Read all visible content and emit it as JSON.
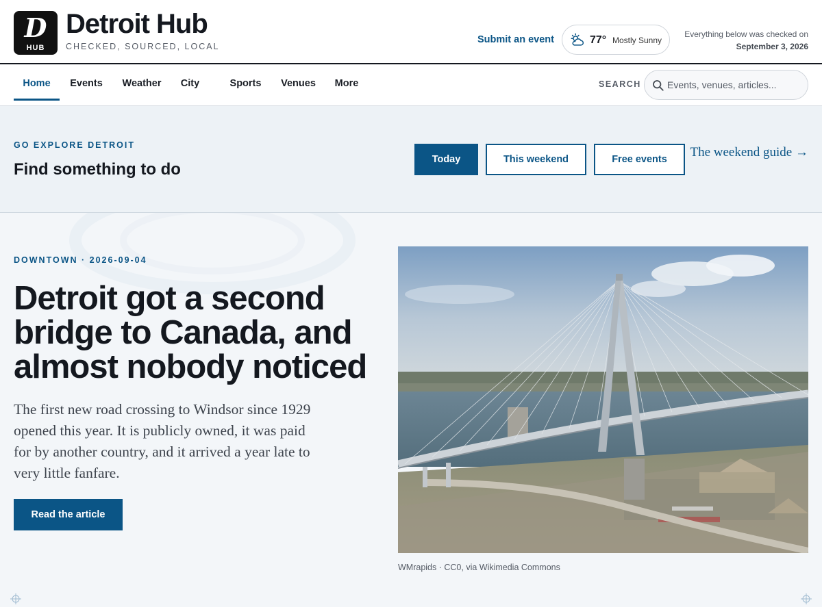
{
  "brand": {
    "logo_mark": "D",
    "logo_sub": "HUB",
    "name": "Detroit Hub",
    "tagline": "CHECKED, SOURCED, LOCAL"
  },
  "header": {
    "submit_label": "Submit an event",
    "weather": {
      "temp": "77°",
      "condition": "Mostly Sunny",
      "icon": "partly-cloudy-icon"
    },
    "checked_line1": "Everything below was checked on",
    "checked_date": "September 3, 2026"
  },
  "nav": {
    "items": [
      {
        "label": "Home",
        "active": true
      },
      {
        "label": "Events",
        "active": false
      },
      {
        "label": "Weather",
        "active": false
      },
      {
        "label": "City",
        "active": false
      },
      {
        "label": "Sports",
        "active": false
      },
      {
        "label": "Venues",
        "active": false
      },
      {
        "label": "More",
        "active": false
      }
    ],
    "search_label": "SEARCH",
    "search_placeholder": "Events, venues, articles..."
  },
  "explore": {
    "eyebrow": "GO EXPLORE DETROIT",
    "title": "Find something to do",
    "filters": [
      {
        "label": "Today",
        "primary": true
      },
      {
        "label": "This weekend",
        "primary": false
      },
      {
        "label": "Free events",
        "primary": false
      }
    ],
    "guide_link": "The weekend guide →"
  },
  "hero": {
    "eyebrow": "DOWNTOWN · 2026-09-04",
    "headline": "Detroit got a second bridge to Canada, and almost nobody noticed",
    "dek": "The first new road crossing to Windsor since 1929 opened this year. It is publicly owned, it was paid for by another country, and it arrived a year late to very little fanfare.",
    "cta": "Read the article",
    "photo_caption": "WMrapids · CC0, via Wikimedia Commons"
  },
  "colors": {
    "accent": "#0b5586",
    "ink": "#14181f",
    "band": "#edf2f6",
    "hero_bg": "#f3f6f9"
  }
}
